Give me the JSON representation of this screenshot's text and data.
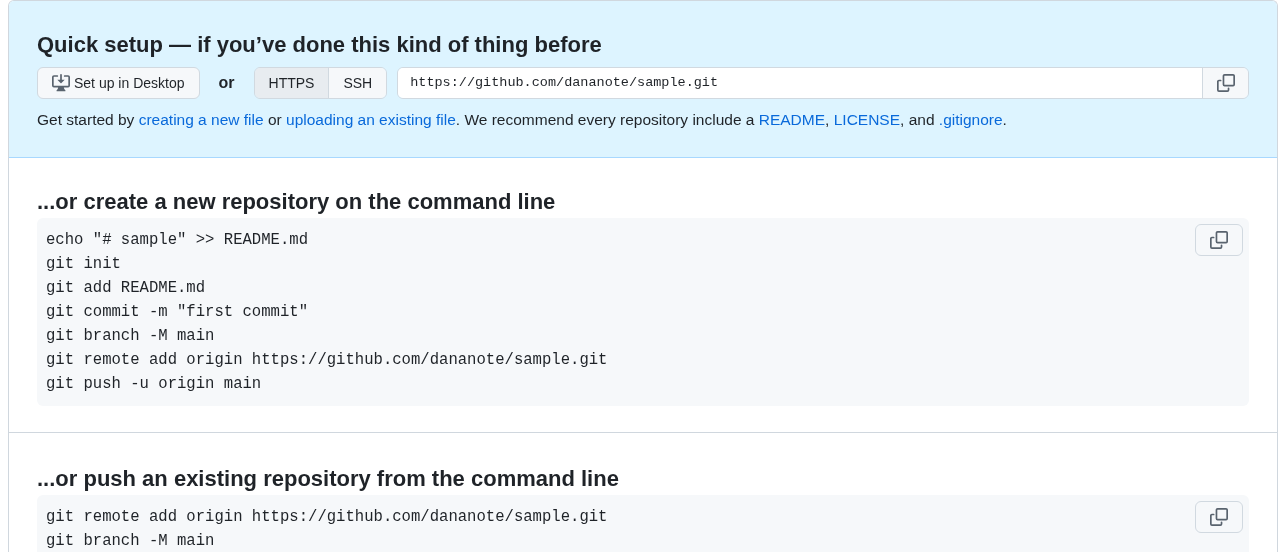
{
  "quick_setup": {
    "title": "Quick setup — if you’ve done this kind of thing before",
    "desktop_button": "Set up in Desktop",
    "or_label": "or",
    "protocol_tabs": [
      {
        "label": "HTTPS",
        "selected": true
      },
      {
        "label": "SSH",
        "selected": false
      }
    ],
    "clone_url": "https://github.com/dananote/sample.git",
    "description": [
      {
        "kind": "text",
        "text": "Get started by "
      },
      {
        "kind": "link",
        "text": "creating a new file"
      },
      {
        "kind": "text",
        "text": " or "
      },
      {
        "kind": "link",
        "text": "uploading an existing file"
      },
      {
        "kind": "text",
        "text": ". We recommend every repository include a "
      },
      {
        "kind": "link",
        "text": "README"
      },
      {
        "kind": "text",
        "text": ", "
      },
      {
        "kind": "link",
        "text": "LICENSE"
      },
      {
        "kind": "text",
        "text": ", and "
      },
      {
        "kind": "link",
        "text": ".gitignore"
      },
      {
        "kind": "text",
        "text": "."
      }
    ]
  },
  "sections": [
    {
      "title": "...or create a new repository on the command line",
      "code_lines": [
        "echo \"# sample\" >> README.md",
        "git init",
        "git add README.md",
        "git commit -m \"first commit\"",
        "git branch -M main",
        "git remote add origin https://github.com/dananote/sample.git",
        "git push -u origin main"
      ]
    },
    {
      "title": "...or push an existing repository from the command line",
      "code_lines": [
        "git remote add origin https://github.com/dananote/sample.git",
        "git branch -M main"
      ]
    }
  ]
}
